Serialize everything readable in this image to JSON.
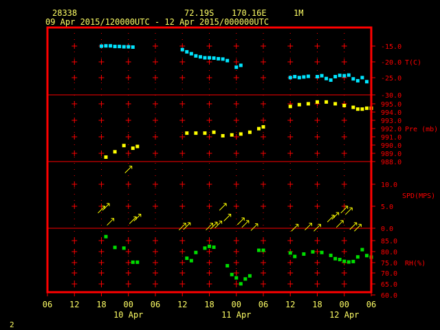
{
  "header": {
    "station": "28338",
    "lat": "72.19S",
    "lon": "170.16E",
    "tag": "1M",
    "period": "09 Apr 2015/120000UTC - 12 Apr 2015/000000UTC"
  },
  "footer": {
    "page": "2"
  },
  "colors": {
    "background": "#000000",
    "frame": "#ff0000",
    "text": "#ffff66",
    "temperature": "#00e5ff",
    "pressure": "#ffff00",
    "wind": "#ffff00",
    "humidity": "#00dd00"
  },
  "chart_data": {
    "type": "scatter",
    "x_axis": {
      "ticks": [
        "06",
        "12",
        "18",
        "00",
        "06",
        "12",
        "18",
        "00",
        "06",
        "12",
        "18",
        "00",
        "06"
      ],
      "day_labels": [
        "10 Apr",
        "11 Apr",
        "12 Apr"
      ],
      "unit": "hours UTC"
    },
    "panels": [
      {
        "name": "temperature",
        "label": "T(C)",
        "ticks": [
          "-15.0",
          "-20.0",
          "-25.0",
          "-30.0"
        ],
        "ylim": [
          -30,
          -12.5
        ],
        "points": [
          [
            12,
            -14.5
          ],
          [
            13,
            -14.4
          ],
          [
            14,
            -14.4
          ],
          [
            15,
            -14.6
          ],
          [
            16,
            -14.6
          ],
          [
            17,
            -14.7
          ],
          [
            18,
            -14.7
          ],
          [
            19,
            -14.8
          ],
          [
            30,
            -15.6
          ],
          [
            31,
            -16.3
          ],
          [
            32,
            -16.9
          ],
          [
            33,
            -17.6
          ],
          [
            34,
            -17.9
          ],
          [
            35,
            -18.2
          ],
          [
            36,
            -18.2
          ],
          [
            37,
            -18.3
          ],
          [
            38,
            -18.5
          ],
          [
            39,
            -18.6
          ],
          [
            40,
            -19.1
          ],
          [
            42,
            -21.2
          ],
          [
            43,
            -20.6
          ],
          [
            54,
            -24.5
          ],
          [
            55,
            -24.2
          ],
          [
            56,
            -24.5
          ],
          [
            57,
            -24.3
          ],
          [
            58,
            -24.1
          ],
          [
            60,
            -24.2
          ],
          [
            61,
            -23.9
          ],
          [
            62,
            -24.8
          ],
          [
            63,
            -25.3
          ],
          [
            64,
            -24.2
          ],
          [
            65,
            -23.8
          ],
          [
            66,
            -23.9
          ],
          [
            67,
            -23.7
          ],
          [
            68,
            -24.9
          ],
          [
            69,
            -25.5
          ],
          [
            70,
            -24.5
          ],
          [
            71,
            -25.8
          ]
        ]
      },
      {
        "name": "pressure",
        "label": "Pre (mb)",
        "ticks": [
          "995.0",
          "994.0",
          "993.0",
          "992.0",
          "991.0",
          "990.0",
          "989.0",
          "988.0"
        ],
        "ylim": [
          988,
          995.5
        ],
        "points": [
          [
            13,
            988.5
          ],
          [
            15,
            989.1
          ],
          [
            17,
            989.8
          ],
          [
            19,
            989.5
          ],
          [
            20,
            989.7
          ],
          [
            31,
            991.2
          ],
          [
            33,
            991.2
          ],
          [
            35,
            991.2
          ],
          [
            37,
            991.3
          ],
          [
            39,
            990.9
          ],
          [
            41,
            991.0
          ],
          [
            43,
            991.1
          ],
          [
            45,
            991.3
          ],
          [
            47,
            991.7
          ],
          [
            48,
            991.9
          ],
          [
            54,
            994.2
          ],
          [
            56,
            994.4
          ],
          [
            58,
            994.5
          ],
          [
            60,
            994.7
          ],
          [
            62,
            994.7
          ],
          [
            64,
            994.5
          ],
          [
            66,
            994.3
          ],
          [
            68,
            994.1
          ],
          [
            69,
            993.9
          ],
          [
            70,
            993.9
          ],
          [
            71,
            994.0
          ],
          [
            72,
            994.0
          ]
        ]
      },
      {
        "name": "wind",
        "label": "SPD(MPS)",
        "ticks": [
          "10.0",
          "5.0",
          "0.0"
        ],
        "ylim": [
          0,
          12.5
        ],
        "points": [
          [
            12,
            3.5
          ],
          [
            13,
            4.0
          ],
          [
            14,
            1.2
          ],
          [
            18,
            11.0
          ],
          [
            19,
            1.5
          ],
          [
            20,
            2.0
          ],
          [
            30,
            0.3
          ],
          [
            31,
            0.4
          ],
          [
            36,
            0.3
          ],
          [
            37,
            0.5
          ],
          [
            38,
            0.7
          ],
          [
            39,
            4.0
          ],
          [
            40,
            2.0
          ],
          [
            43,
            1.3
          ],
          [
            44,
            0.8
          ],
          [
            46,
            0.2
          ],
          [
            55,
            0.1
          ],
          [
            58,
            0.3
          ],
          [
            60,
            0.1
          ],
          [
            63,
            1.8
          ],
          [
            64,
            2.3
          ],
          [
            65,
            0.8
          ],
          [
            66,
            3.5
          ],
          [
            67,
            3.2
          ],
          [
            68,
            0.4
          ],
          [
            69,
            0.1
          ]
        ]
      },
      {
        "name": "humidity",
        "label": "RH(%)",
        "ticks": [
          "85.0",
          "80.0",
          "75.0",
          "70.0",
          "65.0",
          "60.0"
        ],
        "ylim": [
          60,
          89
        ],
        "points": [
          [
            13,
            85.2
          ],
          [
            15,
            80.3
          ],
          [
            17,
            80.0
          ],
          [
            19,
            73.6
          ],
          [
            20,
            73.6
          ],
          [
            31,
            75.4
          ],
          [
            32,
            74.3
          ],
          [
            33,
            78.0
          ],
          [
            35,
            80.0
          ],
          [
            36,
            80.8
          ],
          [
            37,
            80.4
          ],
          [
            40,
            72.0
          ],
          [
            41,
            68.0
          ],
          [
            42,
            66.5
          ],
          [
            43,
            63.8
          ],
          [
            44,
            66.0
          ],
          [
            45,
            67.4
          ],
          [
            47,
            79.0
          ],
          [
            48,
            79.0
          ],
          [
            54,
            77.8
          ],
          [
            55,
            76.2
          ],
          [
            57,
            77.3
          ],
          [
            59,
            78.3
          ],
          [
            61,
            78.0
          ],
          [
            63,
            76.7
          ],
          [
            64,
            75.2
          ],
          [
            65,
            74.8
          ],
          [
            66,
            74.0
          ],
          [
            67,
            73.7
          ],
          [
            68,
            73.9
          ],
          [
            69,
            76.0
          ],
          [
            70,
            79.3
          ],
          [
            71,
            76.6
          ],
          [
            72,
            75.9
          ]
        ]
      }
    ]
  }
}
